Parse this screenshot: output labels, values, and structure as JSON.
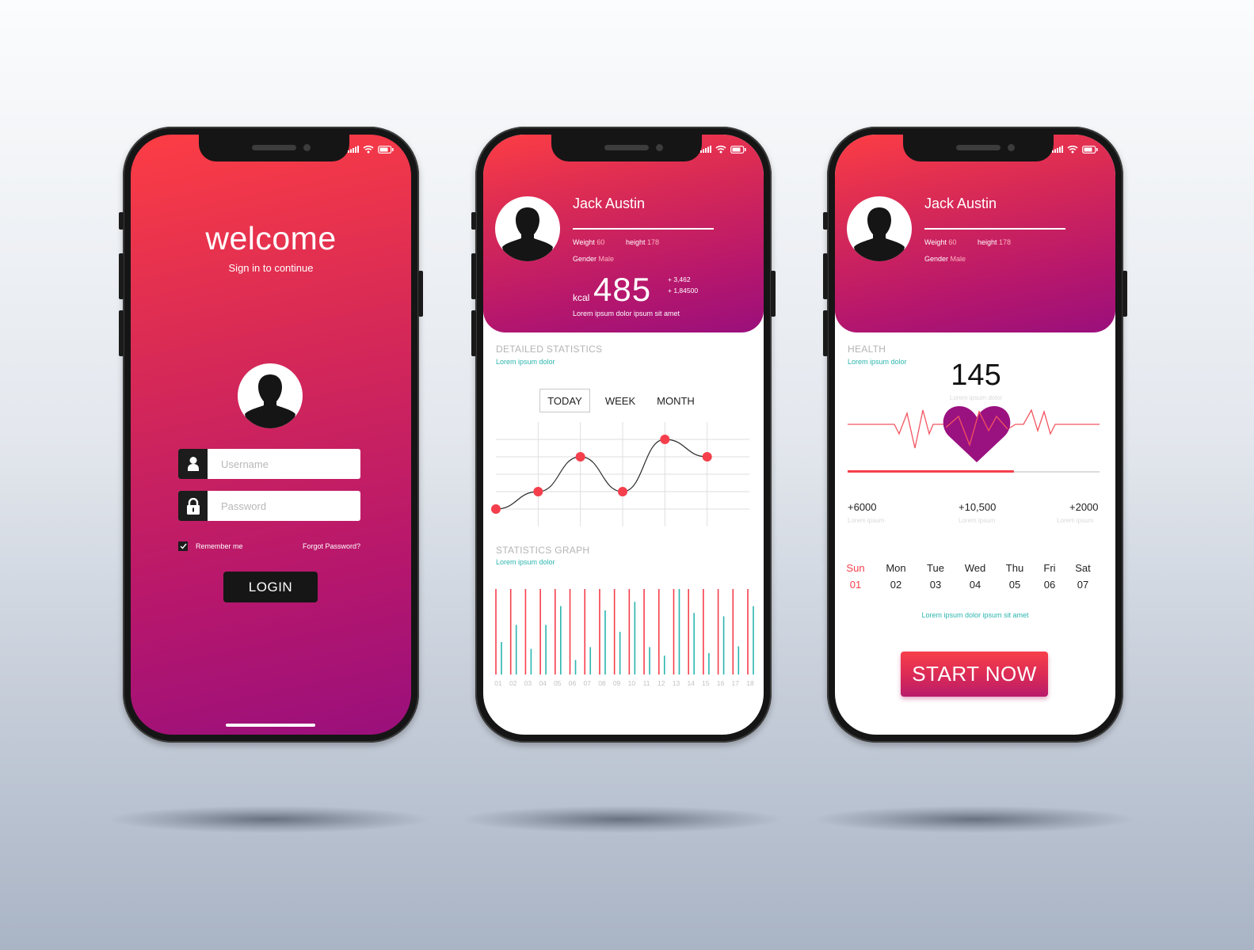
{
  "colors": {
    "gradient_top": "#fc3d44",
    "gradient_bottom": "#9a0f7c",
    "accent_red": "#f53f4c",
    "accent_teal": "#2bb5ae",
    "dark": "#161616"
  },
  "login": {
    "title": "welcome",
    "subtitle": "Sign in to continue",
    "username_placeholder": "Username",
    "password_placeholder": "Password",
    "remember_label": "Remember me",
    "remember_checked": true,
    "forgot_label": "Forgot Password?",
    "login_label": "LOGIN"
  },
  "profile": {
    "name": "Jack Austin",
    "weight_label": "Weight",
    "weight_value": "60",
    "height_label": "height",
    "height_value": "178",
    "gender_label": "Gender",
    "gender_value": "Male"
  },
  "stats": {
    "kcal_unit": "kcal",
    "kcal_value": "485",
    "delta_1": "+ 3,462",
    "delta_2": "+ 1,84500",
    "caption": "Lorem ipsum dolor ipsum sit amet",
    "detailed_title": "DETAILED STATISTICS",
    "detailed_sub": "Lorem ipsum dolor",
    "tabs": [
      "TODAY",
      "WEEK",
      "MONTH"
    ],
    "active_tab": "TODAY",
    "graph_title": "STATISTICS GRAPH",
    "graph_sub": "Lorem ipsum dolor"
  },
  "chart_data": [
    {
      "type": "line",
      "x": [
        0,
        1,
        2,
        3,
        4,
        5,
        6
      ],
      "values": [
        0,
        1,
        3,
        1,
        4,
        3
      ],
      "grid": true,
      "ylim": [
        0,
        4
      ]
    },
    {
      "type": "bar",
      "categories": [
        "01",
        "02",
        "03",
        "04",
        "05",
        "06",
        "07",
        "08",
        "09",
        "10",
        "11",
        "12",
        "13",
        "14",
        "15",
        "16",
        "17",
        "18"
      ],
      "series": [
        {
          "values": [
            100,
            100,
            100,
            100,
            100,
            100,
            100,
            100,
            100,
            100,
            100,
            100,
            100,
            100,
            100,
            100,
            100,
            100
          ]
        },
        {
          "values": [
            38,
            58,
            30,
            58,
            80,
            17,
            32,
            75,
            50,
            85,
            32,
            22,
            100,
            72,
            25,
            68,
            33,
            80
          ]
        }
      ],
      "ylim": [
        0,
        100
      ]
    }
  ],
  "health": {
    "title": "HEALTH",
    "sub": "Lorem ipsum dolor",
    "bpm_value": "145",
    "bpm_sub": "Lorem ipsum dolor",
    "progress": 0.66,
    "metrics": [
      {
        "value": "+6000",
        "label": "Lorem ipsum"
      },
      {
        "value": "+10,500",
        "label": "Lorem ipsum"
      },
      {
        "value": "+2000",
        "label": "Lorem ipsum"
      }
    ],
    "days": [
      {
        "day": "Sun",
        "date": "01",
        "selected": true
      },
      {
        "day": "Mon",
        "date": "02"
      },
      {
        "day": "Tue",
        "date": "03"
      },
      {
        "day": "Wed",
        "date": "04"
      },
      {
        "day": "Thu",
        "date": "05"
      },
      {
        "day": "Fri",
        "date": "06"
      },
      {
        "day": "Sat",
        "date": "07"
      }
    ],
    "caption": "Lorem ipsum dolor ipsum sit amet",
    "start_label": "START NOW"
  }
}
